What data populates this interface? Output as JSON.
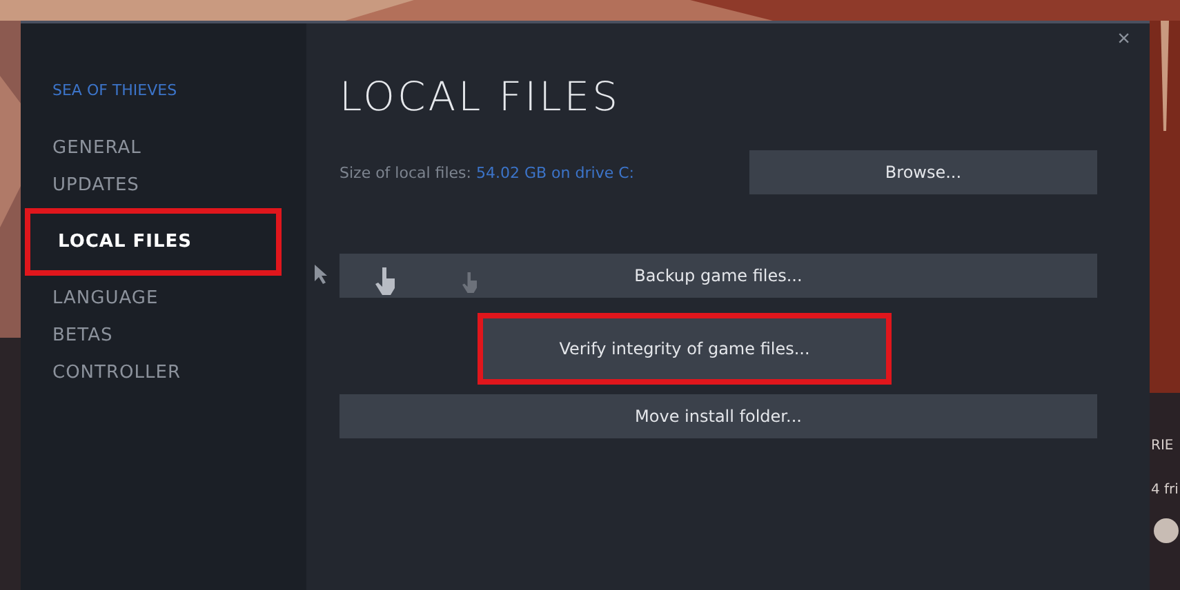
{
  "background": {
    "kind": "picture",
    "texts": [
      "RIE",
      "4 fri"
    ]
  },
  "sidebar": {
    "game_title": "SEA OF THIEVES",
    "items": [
      {
        "label": "GENERAL",
        "selected": false,
        "highlighted": false
      },
      {
        "label": "UPDATES",
        "selected": false,
        "highlighted": false
      },
      {
        "label": "LOCAL FILES",
        "selected": true,
        "highlighted": true
      },
      {
        "label": "LANGUAGE",
        "selected": false,
        "highlighted": false
      },
      {
        "label": "BETAS",
        "selected": false,
        "highlighted": false
      },
      {
        "label": "CONTROLLER",
        "selected": false,
        "highlighted": false
      }
    ]
  },
  "content": {
    "title": "LOCAL FILES",
    "size_label": "Size of local files:",
    "size_value": "54.02 GB on drive C:",
    "browse_button": "Browse...",
    "buttons": [
      {
        "label": "Backup game files...",
        "highlighted": false
      },
      {
        "label": "Verify integrity of game files...",
        "highlighted": true
      },
      {
        "label": "Move install folder...",
        "highlighted": false
      }
    ]
  },
  "close": "×"
}
